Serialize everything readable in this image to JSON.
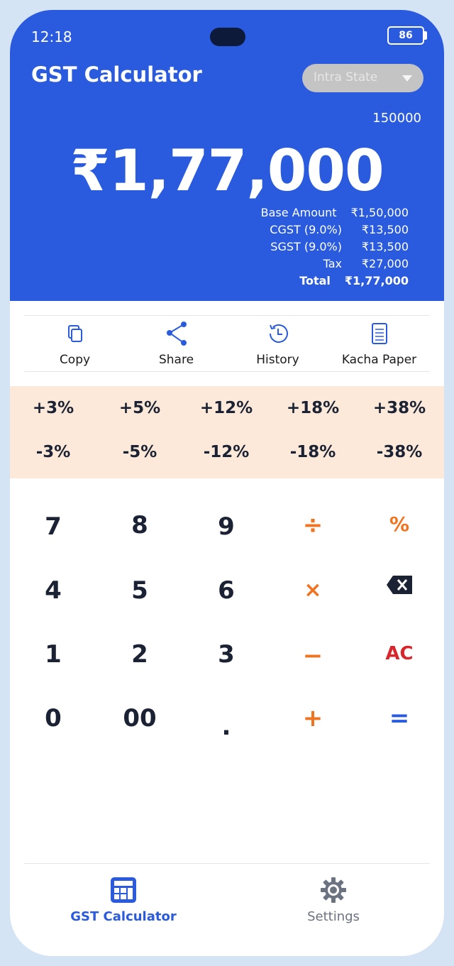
{
  "status": {
    "time": "12:18",
    "battery": "86"
  },
  "header": {
    "title": "GST Calculator",
    "mode_selected": "Intra State",
    "input_value": "150000",
    "total_display": "₹1,77,000"
  },
  "breakdown": [
    {
      "label": "Base Amount",
      "value": "₹1,50,000"
    },
    {
      "label": "CGST (9.0%)",
      "value": "₹13,500"
    },
    {
      "label": "SGST (9.0%)",
      "value": "₹13,500"
    },
    {
      "label": "Tax",
      "value": "₹27,000"
    },
    {
      "label": "Total",
      "value": "₹1,77,000"
    }
  ],
  "actions": [
    {
      "label": "Copy",
      "icon": "copy-icon"
    },
    {
      "label": "Share",
      "icon": "share-icon"
    },
    {
      "label": "History",
      "icon": "history-icon"
    },
    {
      "label": "Kacha Paper",
      "icon": "document-icon"
    }
  ],
  "percent_add": [
    "+3%",
    "+5%",
    "+12%",
    "+18%",
    "+38%"
  ],
  "percent_sub": [
    "-3%",
    "-5%",
    "-12%",
    "-18%",
    "-38%"
  ],
  "keypad": {
    "r1": [
      "7",
      "8",
      "9",
      "÷",
      "%"
    ],
    "r2": [
      "4",
      "5",
      "6",
      "×",
      ""
    ],
    "r3": [
      "1",
      "2",
      "3",
      "−",
      "AC"
    ],
    "r4": [
      "0",
      "00",
      ".",
      "+",
      "="
    ]
  },
  "tabs": [
    {
      "label": "GST Calculator",
      "icon": "calculator-icon",
      "active": true
    },
    {
      "label": "Settings",
      "icon": "gear-icon",
      "active": false
    }
  ],
  "colors": {
    "primary": "#2a5bdf",
    "operator": "#f07320",
    "clear": "#d8262d",
    "percent_bg": "#fde9d9",
    "inactive": "#6b7280"
  }
}
